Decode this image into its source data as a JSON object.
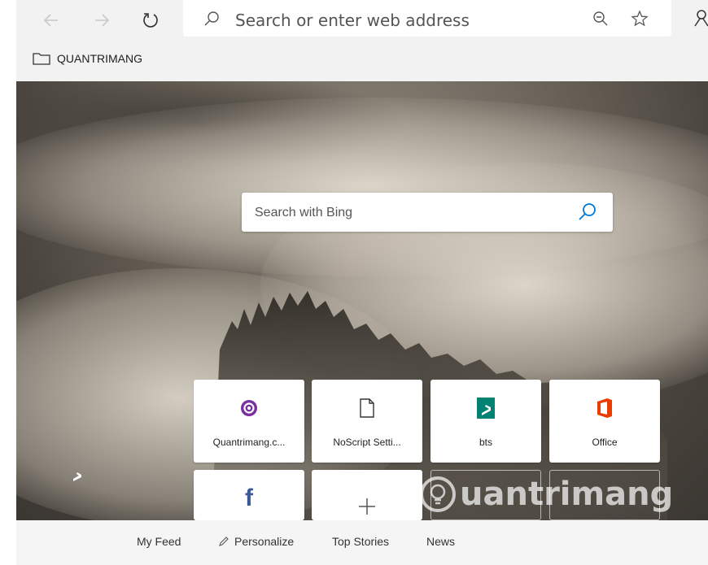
{
  "address_bar": {
    "placeholder": "Search or enter web address"
  },
  "favorites": {
    "folder_label": "QUANTRIMANG"
  },
  "bing": {
    "search_placeholder": "Search with Bing"
  },
  "tiles": [
    {
      "label": "Quantrimang.c...",
      "icon": "quantrimang-icon"
    },
    {
      "label": "NoScript Setti...",
      "icon": "page-icon"
    },
    {
      "label": "bts",
      "icon": "bing-icon"
    },
    {
      "label": "Office",
      "icon": "office-icon"
    },
    {
      "label": "",
      "icon": "facebook-icon"
    },
    {
      "label": "",
      "icon": "add-icon"
    }
  ],
  "watermark": "uantrimang",
  "feed": {
    "my_feed": "My Feed",
    "personalize": "Personalize",
    "top_stories": "Top Stories",
    "news": "News"
  },
  "colors": {
    "toolbar_bg": "#f2f2f2",
    "office_red": "#eb3c00",
    "bing_teal": "#008373",
    "facebook_blue": "#3b5998",
    "quantrimang_purple": "#7a2fa0",
    "search_icon_blue": "#0078d7"
  }
}
